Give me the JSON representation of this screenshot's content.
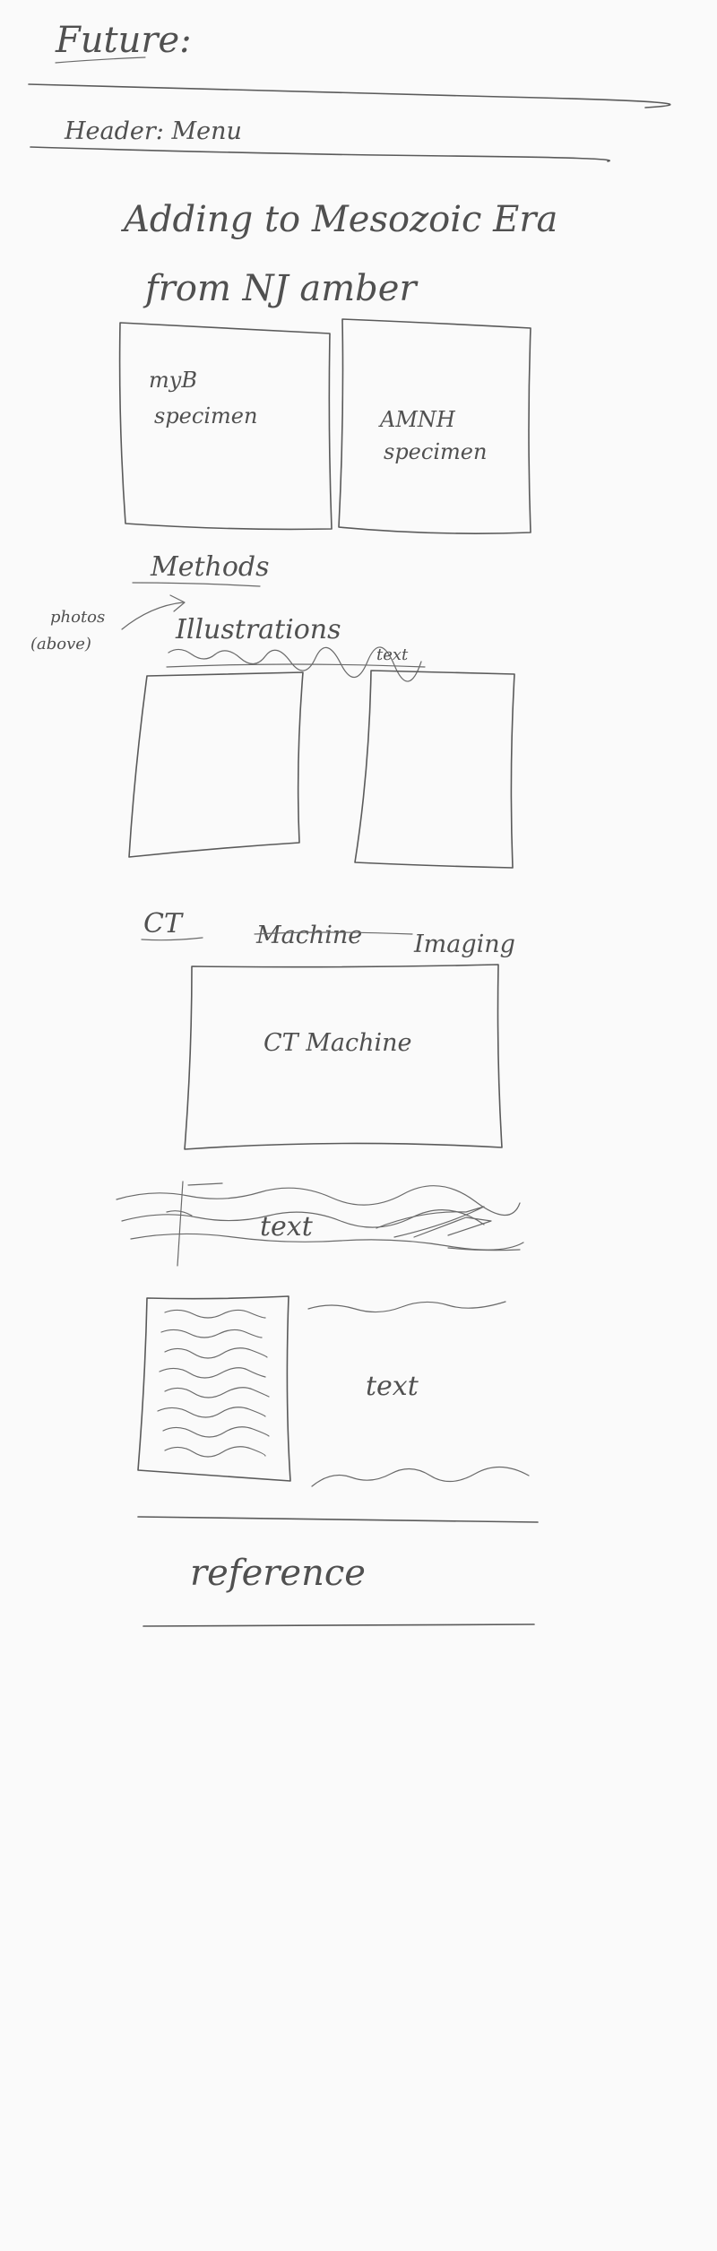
{
  "title": "Future:",
  "header_label": "Header: Menu",
  "page_title": {
    "line1": "Adding to Mesozoic Era",
    "line2": "from NJ amber"
  },
  "specimen_boxes": [
    {
      "line1": "myB",
      "line2": "specimen"
    },
    {
      "line1": "AMNH",
      "line2": "specimen"
    }
  ],
  "methods_heading": "Methods",
  "photos_note": {
    "line1": "photos",
    "line2": "(above)"
  },
  "illustrations_label": "Illustrations",
  "illustrations_text": "text",
  "ct_heading": {
    "prefix": "CT",
    "struck": "Machine",
    "suffix": "Imaging"
  },
  "ct_box_label": "CT Machine",
  "scribbled_text": "text",
  "body_text": "text",
  "reference_label": "reference",
  "colors": {
    "ink": "#5a5a5a",
    "paper": "#fafafa"
  }
}
